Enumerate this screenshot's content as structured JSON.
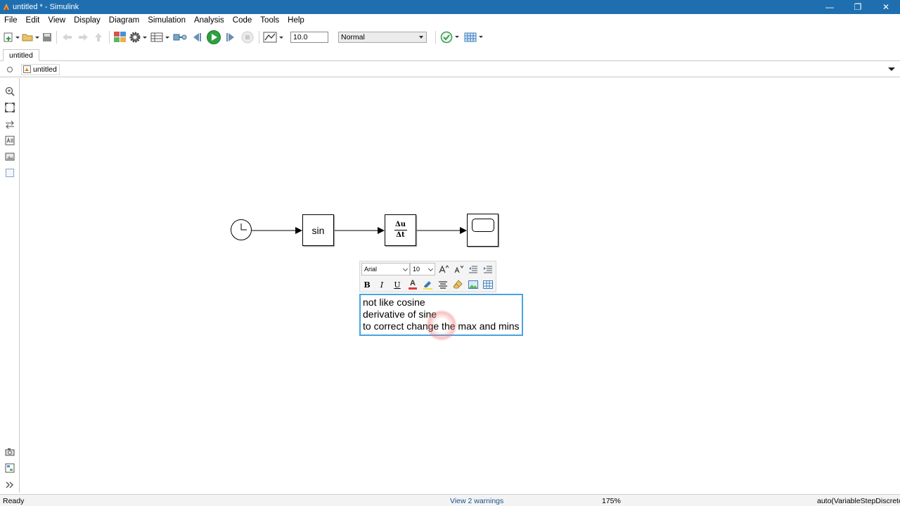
{
  "window": {
    "title": "untitled * - Simulink",
    "minimize_glyph": "—",
    "restore_glyph": "❐",
    "close_glyph": "✕"
  },
  "menu": [
    "File",
    "Edit",
    "View",
    "Display",
    "Diagram",
    "Simulation",
    "Analysis",
    "Code",
    "Tools",
    "Help"
  ],
  "toolbar": {
    "stop_time": "10.0",
    "sim_mode": "Normal"
  },
  "tabs": [
    {
      "label": "untitled"
    }
  ],
  "breadcrumb": {
    "model": "untitled"
  },
  "diagram": {
    "blocks": [
      {
        "name": "clock",
        "icon": "clock-icon"
      },
      {
        "name": "trig-function",
        "label": "sin"
      },
      {
        "name": "derivative",
        "numerator": "Δu",
        "denominator": "Δt"
      },
      {
        "name": "scope",
        "icon": "scope-icon"
      }
    ]
  },
  "format_toolbar": {
    "font": "Arial",
    "font_size": "10",
    "bold": "B",
    "italic": "I",
    "underline": "U",
    "font_color": "A"
  },
  "annotation": {
    "lines": [
      "not like cosine",
      "derivative of sine",
      "to correct change the max and mins"
    ]
  },
  "status": {
    "left": "Ready",
    "warnings": "View 2 warnings",
    "zoom": "175%",
    "solver": "auto(VariableStepDiscrete)"
  },
  "colors": {
    "titlebar": "#1f6fb0",
    "selection": "#4aa3df",
    "run_green": "#2ea043"
  }
}
